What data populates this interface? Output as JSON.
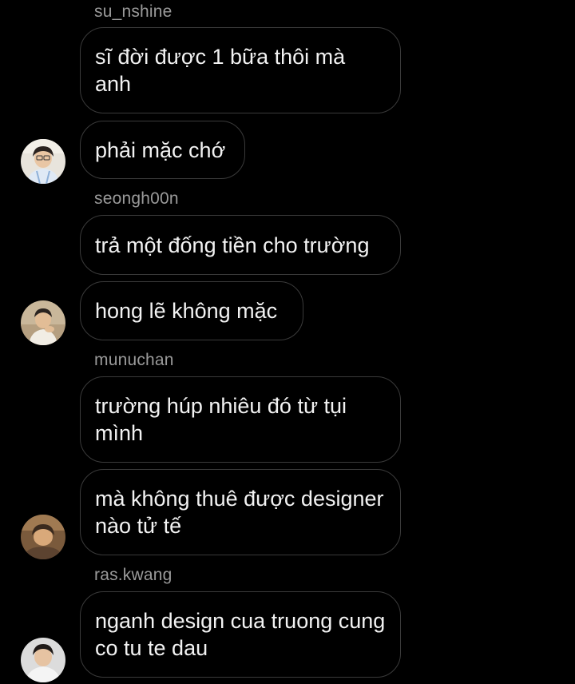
{
  "chat": {
    "groups": [
      {
        "sender": "su_nshine",
        "messages": [
          "sĩ đời được 1 bữa thôi mà anh",
          "phải mặc chớ"
        ],
        "avatar_icon": "user-avatar-su_nshine"
      },
      {
        "sender": "seongh00n",
        "messages": [
          "trả một đống tiền cho trường",
          "hong lẽ không mặc"
        ],
        "avatar_icon": "user-avatar-seongh00n"
      },
      {
        "sender": "munuchan",
        "messages": [
          "trường húp nhiêu đó từ tụi mình",
          "mà không thuê được designer nào tử tế"
        ],
        "avatar_icon": "user-avatar-munuchan"
      },
      {
        "sender": "ras.kwang",
        "messages": [
          "nganh design cua truong cung co tu te dau"
        ],
        "avatar_icon": "user-avatar-ras.kwang"
      }
    ]
  }
}
